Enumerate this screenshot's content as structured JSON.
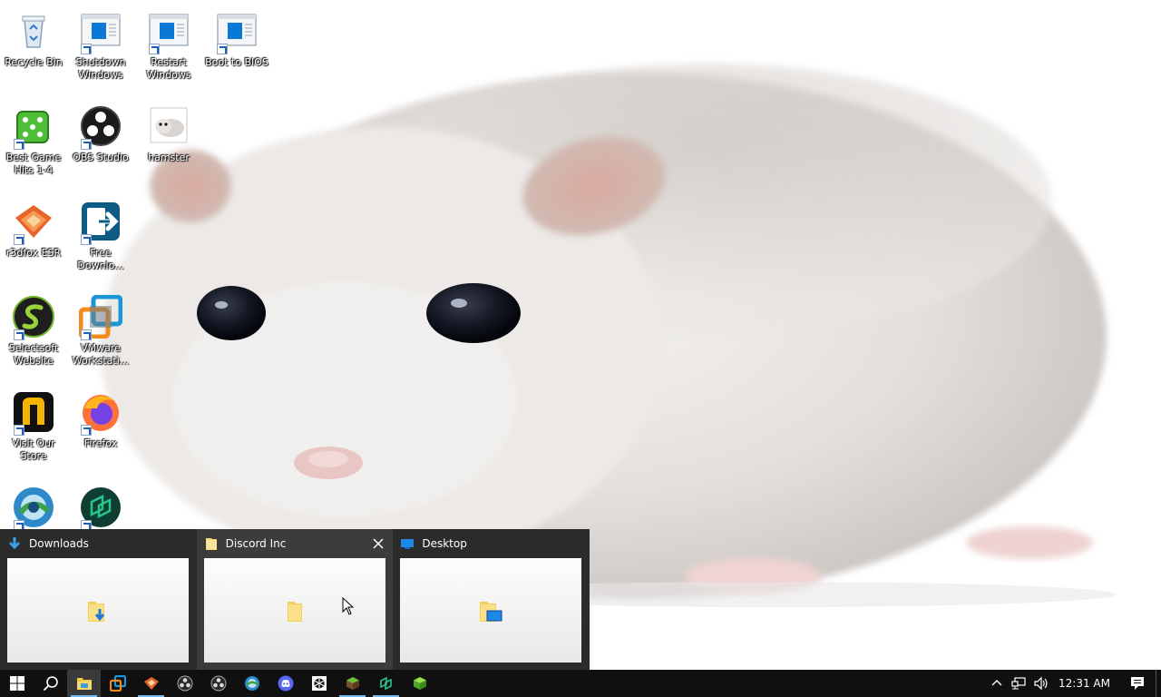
{
  "desktop_icons": [
    {
      "name": "recycle-bin",
      "label": "Recycle Bin",
      "icon": "recycle-bin-icon"
    },
    {
      "name": "shutdown-windows",
      "label": "Shutdown Windows",
      "icon": "window-shortcut-icon"
    },
    {
      "name": "restart-windows",
      "label": "Restart Windows",
      "icon": "window-shortcut-icon"
    },
    {
      "name": "boot-to-bios",
      "label": "Boot to BIOS",
      "icon": "window-shortcut-icon"
    },
    {
      "name": "best-game-hits",
      "label": "Best Game Hits 1-4",
      "icon": "dice-icon"
    },
    {
      "name": "obs-studio",
      "label": "OBS Studio",
      "icon": "obs-icon"
    },
    {
      "name": "hamster",
      "label": "hamster",
      "icon": "image-thumbnail-icon"
    },
    {
      "name": "r3dfox-esr",
      "label": "r3dfox ESR",
      "icon": "r3dfox-icon"
    },
    {
      "name": "free-download",
      "label": "Free Downlo...",
      "icon": "free-download-manager-icon"
    },
    {
      "name": "selectsoft-website",
      "label": "Selectsoft Website",
      "icon": "selectsoft-icon"
    },
    {
      "name": "vmware-workstation",
      "label": "VMware Workstati...",
      "icon": "vmware-icon"
    },
    {
      "name": "visit-our-store",
      "label": "Visit Our Store",
      "icon": "store-n-icon"
    },
    {
      "name": "firefox",
      "label": "Firefox",
      "icon": "firefox-icon"
    },
    {
      "name": "browser-globe",
      "label": "",
      "icon": "globe-browser-icon"
    },
    {
      "name": "app-green",
      "label": "",
      "icon": "green-app-icon"
    }
  ],
  "thumbnails": [
    {
      "title": "Downloads",
      "icon": "download-arrow-icon",
      "content_icon": "downloads-folder-icon"
    },
    {
      "title": "Discord Inc",
      "icon": "folder-icon",
      "content_icon": "folder-icon",
      "has_close": true
    },
    {
      "title": "Desktop",
      "icon": "desktop-icon",
      "content_icon": "desktop-folder-icon"
    }
  ],
  "taskbar": {
    "apps": [
      {
        "name": "start",
        "icon": "windows-logo-icon"
      },
      {
        "name": "search",
        "icon": "search-icon"
      },
      {
        "name": "file-explorer",
        "icon": "file-explorer-icon",
        "state": "active"
      },
      {
        "name": "vmware",
        "icon": "vmware-icon"
      },
      {
        "name": "r3dfox",
        "icon": "r3dfox-icon",
        "state": "running"
      },
      {
        "name": "obs-1",
        "icon": "obs-icon"
      },
      {
        "name": "obs-2",
        "icon": "obs-icon"
      },
      {
        "name": "globe-browser",
        "icon": "globe-browser-icon"
      },
      {
        "name": "discord",
        "icon": "discord-icon"
      },
      {
        "name": "unity",
        "icon": "unity-icon"
      },
      {
        "name": "minecraft-1",
        "icon": "grass-block-icon",
        "state": "running"
      },
      {
        "name": "green-app",
        "icon": "green-app-icon",
        "state": "running"
      },
      {
        "name": "minecraft-2",
        "icon": "grass-block-icon"
      }
    ],
    "tray": {
      "chevron": "chevron-up-icon",
      "network": "network-icon",
      "volume": "volume-icon",
      "clock": "12:31 AM",
      "notifications": "notification-icon"
    }
  }
}
